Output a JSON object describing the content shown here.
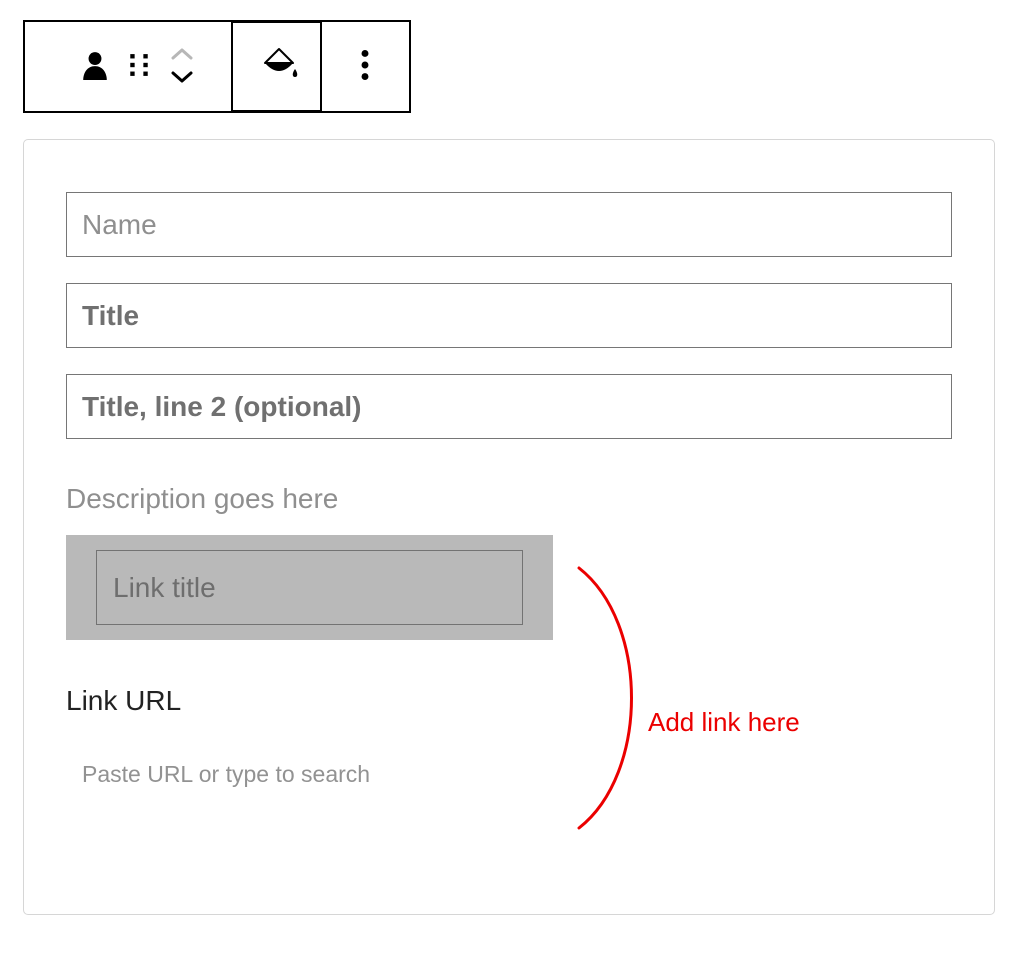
{
  "toolbar": {
    "icons": {
      "person": "person-icon",
      "drag": "drag-handle-icon",
      "chevron_up": "chevron-up-icon",
      "chevron_down": "chevron-down-icon",
      "fill": "paint-bucket-icon",
      "more": "more-vertical-icon"
    }
  },
  "form": {
    "name": {
      "placeholder": "Name"
    },
    "title": {
      "placeholder": "Title"
    },
    "title2": {
      "placeholder": "Title, line 2 (optional)"
    },
    "description_label": "Description goes here",
    "link_title": {
      "placeholder": "Link title"
    },
    "link_url_label": "Link URL",
    "link_url": {
      "placeholder": "Paste URL or type to search"
    }
  },
  "annotation": {
    "text": "Add link here",
    "color": "#eb0000"
  }
}
